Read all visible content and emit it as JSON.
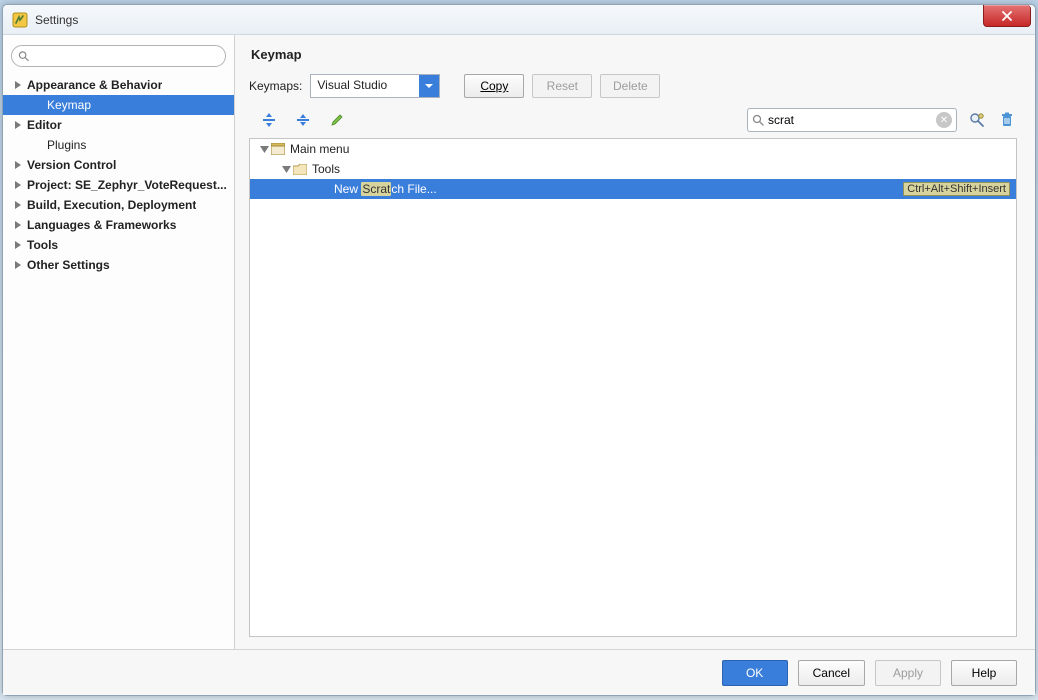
{
  "window": {
    "title": "Settings"
  },
  "sidebar": {
    "search_placeholder": "",
    "items": [
      {
        "label": "Appearance & Behavior",
        "depth": 0,
        "expandable": true,
        "selected": false
      },
      {
        "label": "Keymap",
        "depth": 1,
        "expandable": false,
        "selected": true
      },
      {
        "label": "Editor",
        "depth": 0,
        "expandable": true,
        "selected": false
      },
      {
        "label": "Plugins",
        "depth": 1,
        "expandable": false,
        "selected": false
      },
      {
        "label": "Version Control",
        "depth": 0,
        "expandable": true,
        "selected": false
      },
      {
        "label": "Project: SE_Zephyr_VoteRequest...",
        "depth": 0,
        "expandable": true,
        "selected": false
      },
      {
        "label": "Build, Execution, Deployment",
        "depth": 0,
        "expandable": true,
        "selected": false
      },
      {
        "label": "Languages & Frameworks",
        "depth": 0,
        "expandable": true,
        "selected": false
      },
      {
        "label": "Tools",
        "depth": 0,
        "expandable": true,
        "selected": false
      },
      {
        "label": "Other Settings",
        "depth": 0,
        "expandable": true,
        "selected": false
      }
    ]
  },
  "main": {
    "title": "Keymap",
    "keymaps_label": "Keymaps:",
    "keymap_selected": "Visual Studio",
    "buttons": {
      "copy": "Copy",
      "reset": "Reset",
      "delete": "Delete"
    },
    "filter_value": "scrat",
    "tree": [
      {
        "depth": 0,
        "icon": "menu",
        "label": "Main menu",
        "selected": false
      },
      {
        "depth": 1,
        "icon": "folder",
        "label": "Tools",
        "selected": false
      },
      {
        "depth": 2,
        "icon": "",
        "label_pre": "New ",
        "label_hl": "Scrat",
        "label_post": "ch File...",
        "shortcut": "Ctrl+Alt+Shift+Insert",
        "selected": true
      }
    ]
  },
  "footer": {
    "ok": "OK",
    "cancel": "Cancel",
    "apply": "Apply",
    "help": "Help"
  }
}
